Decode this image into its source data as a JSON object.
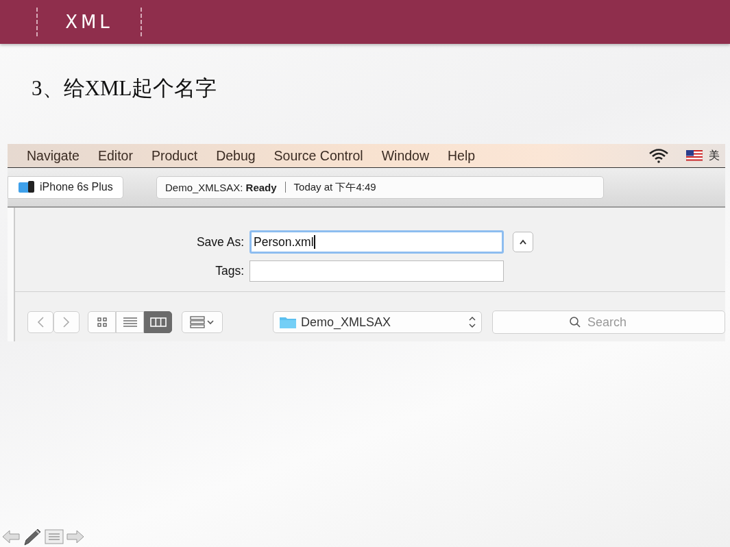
{
  "header": {
    "title": "XML"
  },
  "heading": "3、给XML起个名字",
  "screenshot": {
    "menu": [
      "Navigate",
      "Editor",
      "Product",
      "Debug",
      "Source Control",
      "Window",
      "Help"
    ],
    "input_source": "美",
    "toolbar": {
      "scheme": "iPhone 6s Plus",
      "status": "Demo_XMLSAX: **Ready**",
      "status_time": "Today at 下午4:49"
    },
    "dialog": {
      "save_as_label": "Save As:",
      "save_as_value": "Person.xml",
      "tags_label": "Tags:",
      "view_modes": [
        {
          "kind": "icons",
          "selected": false
        },
        {
          "kind": "list",
          "selected": false
        },
        {
          "kind": "columns",
          "selected": true
        }
      ],
      "location": "Demo_XMLSAX",
      "search": {
        "placeholder": "Search"
      }
    }
  }
}
